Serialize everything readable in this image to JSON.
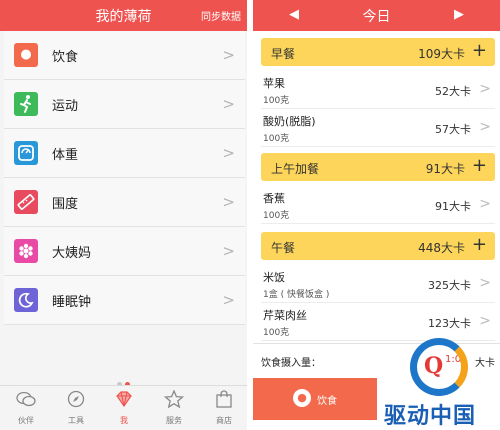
{
  "left": {
    "title": "我的薄荷",
    "sync_label": "同步数据",
    "menu": [
      {
        "label": "饮食",
        "icon": "food-icon",
        "glyph": "●",
        "color": "#f26a4b"
      },
      {
        "label": "运动",
        "icon": "running-icon",
        "glyph": "🏃",
        "color": "#3dba5a"
      },
      {
        "label": "体重",
        "icon": "scale-icon",
        "glyph": "◔",
        "color": "#2a97d9"
      },
      {
        "label": "围度",
        "icon": "tape-measure-icon",
        "glyph": "✎",
        "color": "#e84a5f"
      },
      {
        "label": "大姨妈",
        "icon": "flower-icon",
        "glyph": "✿",
        "color": "#e94aa6"
      },
      {
        "label": "睡眠钟",
        "icon": "moon-icon",
        "glyph": "☾",
        "color": "#6f63d8"
      }
    ],
    "page_dots": [
      "#c8c8c8",
      "#ef5350"
    ],
    "nav": [
      {
        "label": "伙伴",
        "icon": "chat-bubbles-icon",
        "glyph": "💬"
      },
      {
        "label": "工具",
        "icon": "compass-icon",
        "glyph": "⊘"
      },
      {
        "label": "我",
        "icon": "diamond-icon",
        "glyph": "◆",
        "color": "#ef5350"
      },
      {
        "label": "服务",
        "icon": "star-icon",
        "glyph": "☆"
      },
      {
        "label": "商店",
        "icon": "shopping-bag-icon",
        "glyph": "👜"
      }
    ]
  },
  "right": {
    "title": "今日",
    "prev_arrow": "◀",
    "next_arrow": "▶",
    "meals": [
      {
        "name": "早餐",
        "calories": "109大卡",
        "add": "+"
      },
      {
        "name": "上午加餐",
        "calories": "91大卡",
        "add": "+"
      },
      {
        "name": "午餐",
        "calories": "448大卡",
        "add": "+"
      }
    ],
    "foods": [
      {
        "name": "苹果",
        "amount": "100克",
        "calories": "52大卡"
      },
      {
        "name": "酸奶(脱脂)",
        "amount": "100克",
        "calories": "57大卡"
      },
      {
        "name": "香蕉",
        "amount": "100克",
        "calories": "91大卡"
      },
      {
        "name": "米饭",
        "amount": "1盒 ( 快餐饭盒 )",
        "calories": "325大卡"
      },
      {
        "name": "芹菜肉丝",
        "amount": "100克",
        "calories": "123大卡"
      }
    ],
    "summary": {
      "label": "饮食摄入量：",
      "value": "1:0",
      "unit": "大卡"
    },
    "bottom_tab": {
      "label": "饮食",
      "glyph": "●"
    }
  },
  "watermark": {
    "logo_letter": "Q",
    "text": "驱动中国"
  }
}
